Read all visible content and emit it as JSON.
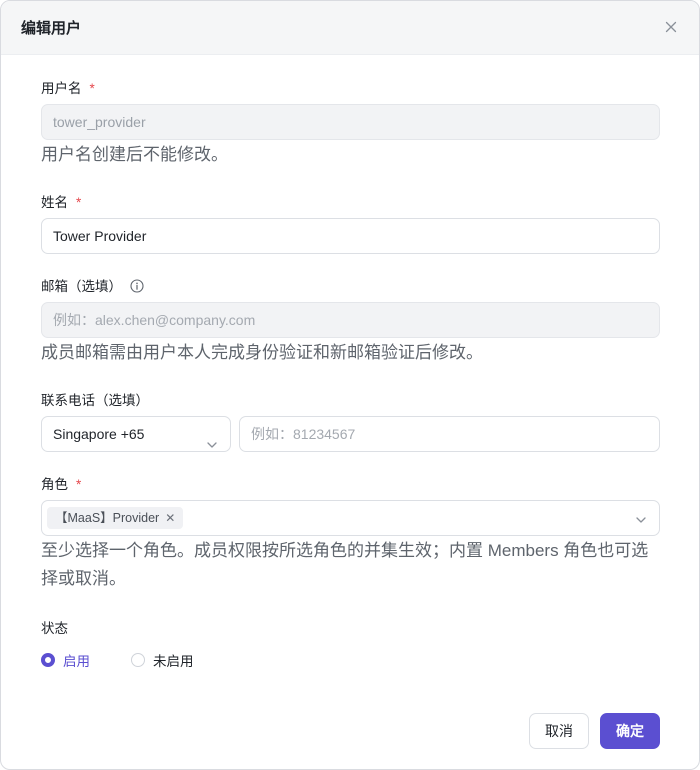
{
  "dialog": {
    "title": "编辑用户"
  },
  "username": {
    "label": "用户名",
    "required_mark": "*",
    "value": "tower_provider",
    "helper": "用户名创建后不能修改。"
  },
  "name": {
    "label": "姓名",
    "required_mark": "*",
    "value": "Tower Provider"
  },
  "email": {
    "label": "邮箱（选填）",
    "placeholder": "例如：alex.chen@company.com",
    "helper": "成员邮箱需由用户本人完成身份验证和新邮箱验证后修改。"
  },
  "phone": {
    "label": "联系电话（选填）",
    "country": "Singapore +65",
    "placeholder": "例如：81234567"
  },
  "role": {
    "label": "角色",
    "required_mark": "*",
    "tags": [
      "【MaaS】Provider"
    ],
    "helper": "至少选择一个角色。成员权限按所选角色的并集生效；内置 Members 角色也可选择或取消。"
  },
  "status": {
    "label": "状态",
    "options": [
      "启用",
      "未启用"
    ],
    "selected": "启用"
  },
  "footer": {
    "cancel_label": "取消",
    "ok_label": "确定"
  },
  "colors": {
    "accent": "#5b4fd1",
    "required": "#e5484d"
  }
}
